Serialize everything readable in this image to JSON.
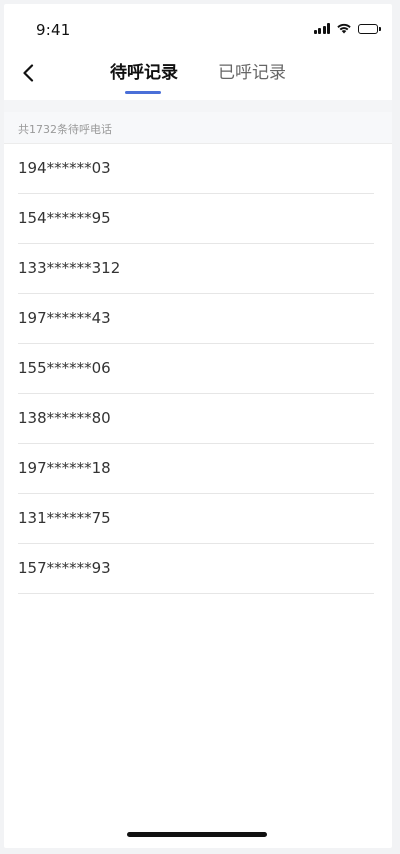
{
  "status_bar": {
    "time": "9:41",
    "icons": [
      "signal-icon",
      "wifi-icon",
      "battery-icon"
    ]
  },
  "nav": {
    "back_icon": "chevron-left-icon",
    "tabs": [
      {
        "label": "待呼记录",
        "active": true
      },
      {
        "label": "已呼记录",
        "active": false
      }
    ]
  },
  "summary": {
    "text": "共1732条待呼电话"
  },
  "calls": [
    "194******03",
    "154******95",
    "133******312",
    "197******43",
    "155******06",
    "138******80",
    "197******18",
    "131******75",
    "157******93"
  ],
  "colors": {
    "accent": "#4a6fd8",
    "text_primary": "#333333",
    "text_secondary": "#999999"
  }
}
